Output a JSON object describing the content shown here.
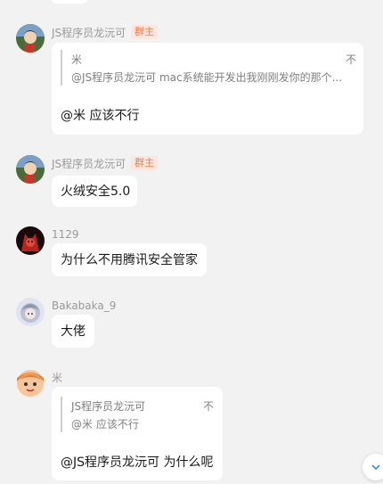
{
  "messages": [
    {
      "sender": "JS程序员龙沅可",
      "badge": "群主",
      "avatar_icon": "anime-boy-avatar-icon",
      "quote": {
        "author": "米",
        "mark": "不",
        "text": "@JS程序员龙沅可 mac系统能开发出我刚刚发你的那个..."
      },
      "text": "@米 应该不行"
    },
    {
      "sender": "JS程序员龙沅可",
      "badge": "群主",
      "avatar_icon": "anime-boy-avatar-icon",
      "text": "火绒安全5.0"
    },
    {
      "sender": "1129",
      "avatar_icon": "red-demon-avatar-icon",
      "text": "为什么不用腾讯安全管家"
    },
    {
      "sender": "Bakabaka_9",
      "avatar_icon": "silver-hair-girl-avatar-icon",
      "text": "大佬"
    },
    {
      "sender": "米",
      "avatar_icon": "cartoon-face-avatar-icon",
      "quote": {
        "author": "JS程序员龙沅可",
        "mark": "不",
        "text": "@米 应该不行"
      },
      "text": "@JS程序员龙沅可 为什么呢"
    }
  ],
  "scroll_icon": "scroll-down-icon"
}
